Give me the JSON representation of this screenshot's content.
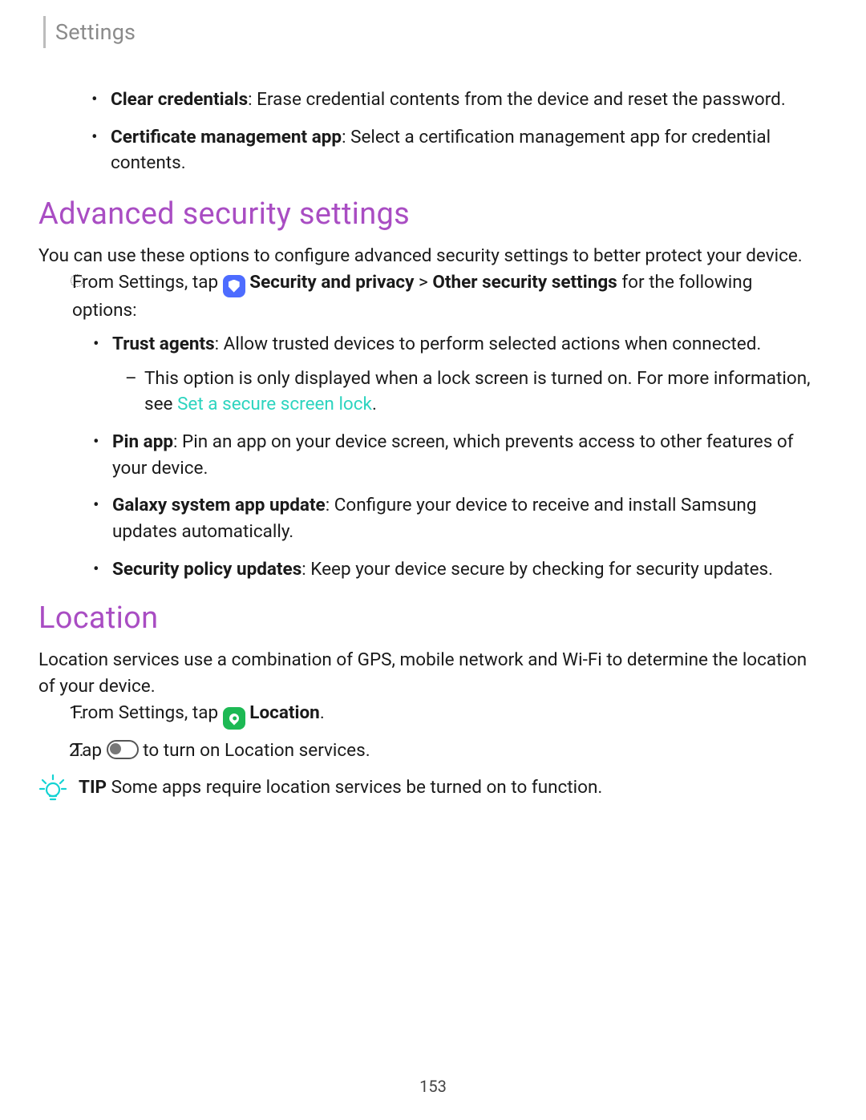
{
  "header": {
    "title": "Settings"
  },
  "top_bullets": [
    {
      "term": "Clear credentials",
      "desc": ": Erase credential contents from the device and reset the password."
    },
    {
      "term": "Certificate management app",
      "desc": ": Select a certification management app for credential contents."
    }
  ],
  "sections": {
    "advanced": {
      "title": "Advanced security settings",
      "intro": "You can use these options to configure advanced security settings to better protect your device.",
      "lead_pre": "From Settings, tap ",
      "lead_bold1": "Security and privacy",
      "lead_sep": " > ",
      "lead_bold2": "Other security settings",
      "lead_post": " for the following options:",
      "items": [
        {
          "term": "Trust agents",
          "desc": ": Allow trusted devices to perform selected actions when connected.",
          "sub_pre": "This option is only displayed when a lock screen is turned on. For more information, see ",
          "sub_link": "Set a secure screen lock",
          "sub_post": "."
        },
        {
          "term": "Pin app",
          "desc": ": Pin an app on your device screen, which prevents access to other features of your device."
        },
        {
          "term": "Galaxy system app update",
          "desc": ": Configure your device to receive and install Samsung updates automatically."
        },
        {
          "term": "Security policy updates",
          "desc": ": Keep your device secure by checking for security updates."
        }
      ]
    },
    "location": {
      "title": "Location",
      "intro": "Location services use a combination of GPS, mobile network and Wi-Fi to determine the location of your device.",
      "step1_pre": "From Settings, tap ",
      "step1_bold": "Location",
      "step1_post": ".",
      "step2_pre": "Tap ",
      "step2_post": " to turn on Location services.",
      "tip_label": "TIP",
      "tip_text": " Some apps require location services be turned on to function."
    }
  },
  "page_number": "153"
}
